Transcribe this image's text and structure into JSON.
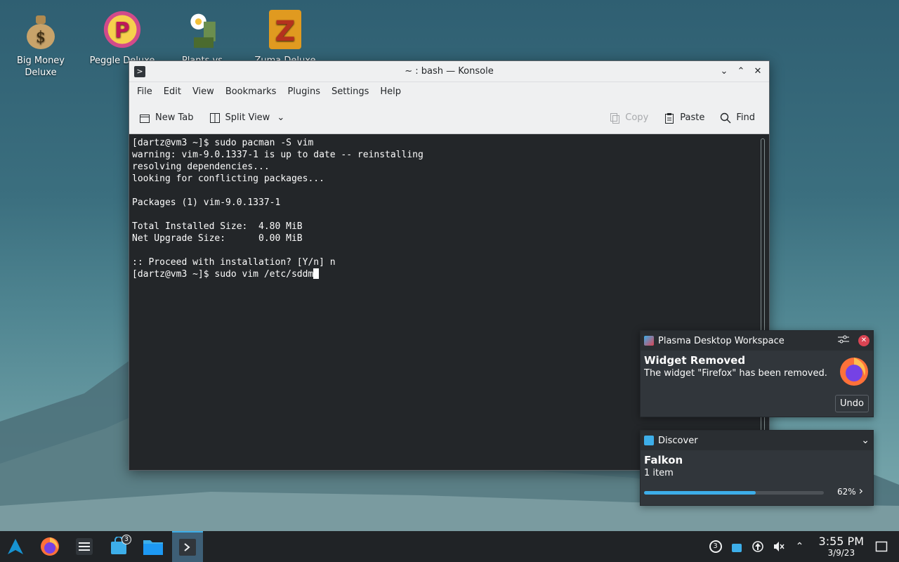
{
  "desktop": {
    "icons": [
      {
        "label": "Big Money Deluxe"
      },
      {
        "label": "Peggle Deluxe"
      },
      {
        "label": "Plants vs."
      },
      {
        "label": "Zuma Deluxe"
      }
    ]
  },
  "window": {
    "title": "~ : bash — Konsole",
    "menu": [
      "File",
      "Edit",
      "View",
      "Bookmarks",
      "Plugins",
      "Settings",
      "Help"
    ],
    "toolbar": {
      "new_tab": "New Tab",
      "split_view": "Split View",
      "copy": "Copy",
      "paste": "Paste",
      "find": "Find"
    },
    "terminal_lines": [
      "[dartz@vm3 ~]$ sudo pacman -S vim",
      "warning: vim-9.0.1337-1 is up to date -- reinstalling",
      "resolving dependencies...",
      "looking for conflicting packages...",
      "",
      "Packages (1) vim-9.0.1337-1",
      "",
      "Total Installed Size:  4.80 MiB",
      "Net Upgrade Size:      0.00 MiB",
      "",
      ":: Proceed with installation? [Y/n] n"
    ],
    "current_prompt": "[dartz@vm3 ~]$ sudo vim /etc/sddm"
  },
  "notifications": {
    "plasma": {
      "app": "Plasma Desktop Workspace",
      "title": "Widget Removed",
      "text": "The widget \"Firefox\" has been removed.",
      "action": "Undo"
    },
    "discover": {
      "app": "Discover",
      "title": "Falkon",
      "text": "1 item",
      "percent_label": "62%",
      "progress": 0.62
    }
  },
  "taskbar": {
    "discover_badge": "3",
    "tray_badge": "3",
    "time": "3:55 PM",
    "date": "3/9/23"
  },
  "colors": {
    "accent": "#3daee9",
    "close": "#da4453"
  }
}
